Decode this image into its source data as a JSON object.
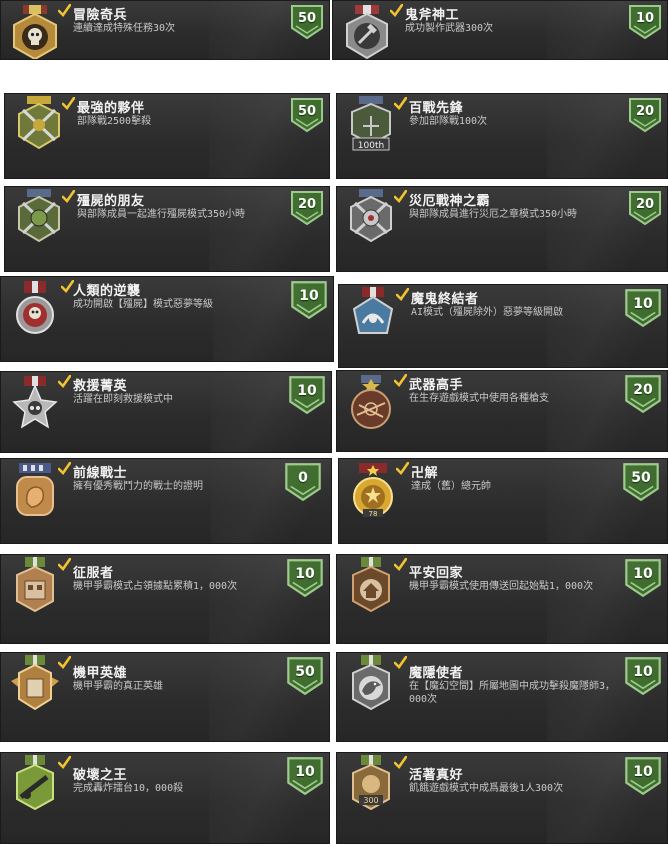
{
  "colors": {
    "badge_green": "#3d6b2c",
    "badge_border": "#9bc98a",
    "check_yellow": "#f2c230",
    "card_bg": "#2f2f2f"
  },
  "achievements": [
    {
      "title": "冒險奇兵",
      "desc": "連續達成特殊任務30次",
      "points": "50",
      "icon": "skull-star-medal-icon"
    },
    {
      "title": "鬼斧神工",
      "desc": "成功製作武器300次",
      "points": "10",
      "icon": "hammer-medal-icon"
    },
    {
      "title": "最強的夥伴",
      "desc": "部隊戰2500擊殺",
      "points": "50",
      "icon": "crossed-rifles-medal-icon"
    },
    {
      "title": "百戰先鋒",
      "desc": "參加部隊戰100次",
      "points": "20",
      "icon": "100th-medal-icon"
    },
    {
      "title": "殭屍的朋友",
      "desc": "與部隊成員一起進行殭屍模式350小時",
      "points": "20",
      "icon": "zombie-friend-medal-icon"
    },
    {
      "title": "災厄戰神之霸",
      "desc": "與部隊成員進行災厄之章模式350小時",
      "points": "20",
      "icon": "disaster-medal-icon"
    },
    {
      "title": "人類的逆襲",
      "desc": "成功開啟【殭屍】模式惡夢等級",
      "points": "10",
      "icon": "skull-medal-icon"
    },
    {
      "title": "魔鬼終結者",
      "desc": "AI模式（殭屍除外）惡夢等級開啟",
      "points": "10",
      "icon": "demon-medal-icon"
    },
    {
      "title": "救援菁英",
      "desc": "活躍在即刻救援模式中",
      "points": "10",
      "icon": "rescue-medal-icon"
    },
    {
      "title": "武器高手",
      "desc": "在生存遊戲模式中使用各種槍支",
      "points": "20",
      "icon": "weapon-medal-icon"
    },
    {
      "title": "前線戰士",
      "desc": "擁有優秀戰鬥力的戰士的證明",
      "points": "0",
      "icon": "fist-medal-icon"
    },
    {
      "title": "卍解",
      "desc": "達成（舊）總元帥",
      "points": "50",
      "icon": "marshal-medal-icon"
    },
    {
      "title": "征服者",
      "desc": "機甲爭霸模式占領據點累積1，000次",
      "points": "10",
      "icon": "fortress-medal-icon"
    },
    {
      "title": "平安回家",
      "desc": "機甲爭霸模式使用傳送回起始點1，000次",
      "points": "10",
      "icon": "home-medal-icon"
    },
    {
      "title": "機甲英雄",
      "desc": "機甲爭霸的真正英雄",
      "points": "50",
      "icon": "mech-hero-medal-icon"
    },
    {
      "title": "魔隱使者",
      "desc": "在【魔幻空間】所屬地圖中成功擊殺魔隱師3，000次",
      "points": "10",
      "icon": "bird-medal-icon"
    },
    {
      "title": "破壞之王",
      "desc": "完成轟炸擂台10，000殺",
      "points": "10",
      "icon": "cannon-medal-icon"
    },
    {
      "title": "活著真好",
      "desc": "飢餓遊戲模式中成爲最後1人300次",
      "points": "10",
      "icon": "300-medal-icon"
    }
  ]
}
